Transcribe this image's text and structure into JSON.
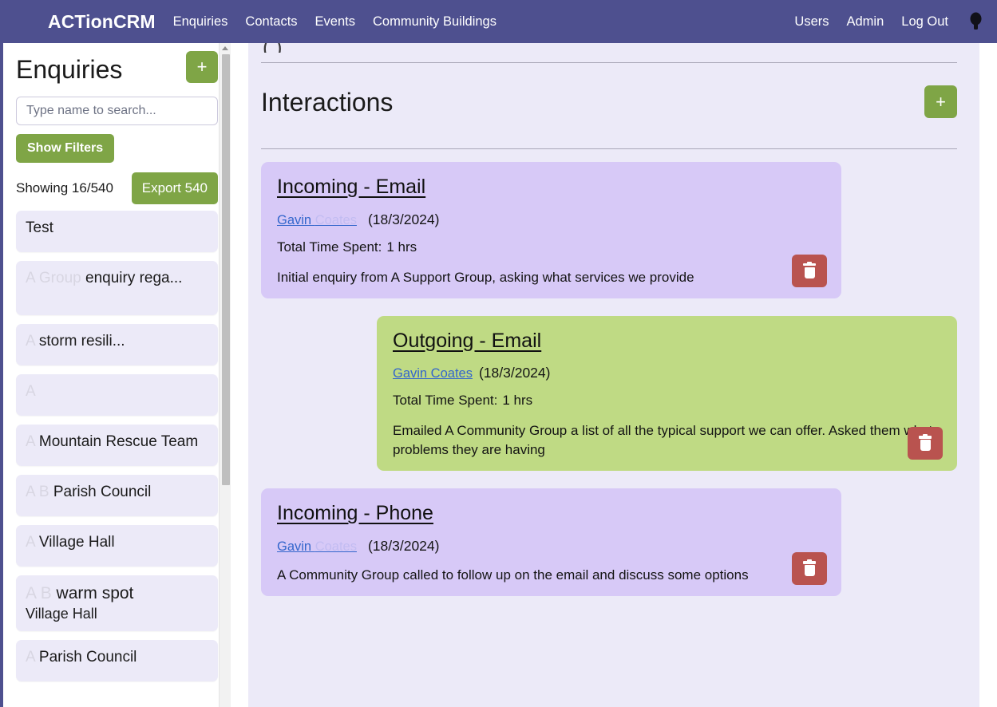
{
  "navbar": {
    "brand": "ACTionCRM",
    "links": [
      {
        "label": "Enquiries"
      },
      {
        "label": "Contacts"
      },
      {
        "label": "Events"
      },
      {
        "label": "Community Buildings"
      }
    ],
    "right_links": [
      {
        "label": "Users"
      },
      {
        "label": "Admin"
      },
      {
        "label": "Log Out"
      }
    ],
    "icon": "lightbulb-icon",
    "bg_color": "#4e508f",
    "text_color": "#ffffff"
  },
  "sidebar": {
    "title": "Enquiries",
    "add_button_label": "+",
    "search": {
      "placeholder": "Type name to search...",
      "value": ""
    },
    "filters_button_label": "Show Filters",
    "showing_text": "Showing 16/540",
    "export_button_label": "Export 540",
    "items": [
      {
        "text": "Test",
        "redacted_prefix": "",
        "redacted_mid": "",
        "sub": ""
      },
      {
        "text": "enquiry rega...",
        "redacted_prefix": "A ",
        "redacted_mid": "Group ",
        "sub": ""
      },
      {
        "text": "storm resili...",
        "redacted_prefix": "A ",
        "redacted_mid": "",
        "sub": ""
      },
      {
        "text": "",
        "redacted_prefix": "A",
        "redacted_mid": "",
        "sub": ""
      },
      {
        "text": "Mountain Rescue Team",
        "redacted_prefix": "A ",
        "redacted_mid": "",
        "sub": ""
      },
      {
        "text": "Parish Council",
        "redacted_prefix": "A ",
        "redacted_mid": "B ",
        "sub": ""
      },
      {
        "text": "Village Hall",
        "redacted_prefix": "A ",
        "redacted_mid": "",
        "sub": ""
      },
      {
        "text": "warm spot",
        "redacted_prefix": "A ",
        "redacted_mid": "B ",
        "sub": "Village Hall"
      },
      {
        "text": "Parish Council",
        "redacted_prefix": "A ",
        "redacted_mid": "",
        "sub": ""
      }
    ],
    "scrollbar": {
      "visible": true
    }
  },
  "main": {
    "cut_off_heading": "( )",
    "section_title": "Interactions",
    "add_interaction_label": "+",
    "interactions": [
      {
        "title": "Incoming - Email",
        "direction": "incoming",
        "author": "Gavin ",
        "author_redacted": "Coates",
        "date": "(18/3/2024)",
        "time_label": "Total Time Spent:",
        "time_value": "1 hrs",
        "body": "Initial enquiry from A Support Group, asking what services we provide",
        "delete_label": "delete",
        "bg_color": "#d7c9f7"
      },
      {
        "title": "Outgoing - Email",
        "direction": "outgoing",
        "author": "Gavin Coates",
        "author_redacted": "",
        "date": "(18/3/2024)",
        "time_label": "Total Time Spent:",
        "time_value": "1 hrs",
        "body": "Emailed A Community Group a list of all the typical support we can offer. Asked them what problems they are having",
        "delete_label": "delete",
        "bg_color": "#bfda84"
      },
      {
        "title": "Incoming - Phone",
        "direction": "incoming",
        "author": "Gavin ",
        "author_redacted": "Coates",
        "date": "(18/3/2024)",
        "time_label": "",
        "time_value": "",
        "body": "A Community Group called to follow up on the email and discuss some options",
        "delete_label": "delete",
        "bg_color": "#d7c9f7"
      }
    ]
  },
  "colors": {
    "brand_purple": "#4e508f",
    "green_accent": "#7fa546",
    "panel_lavender": "#eceaf8",
    "card_incoming": "#d7c9f7",
    "card_outgoing": "#bfda84",
    "delete_red": "#b9534f",
    "link_blue": "#3366cc"
  }
}
